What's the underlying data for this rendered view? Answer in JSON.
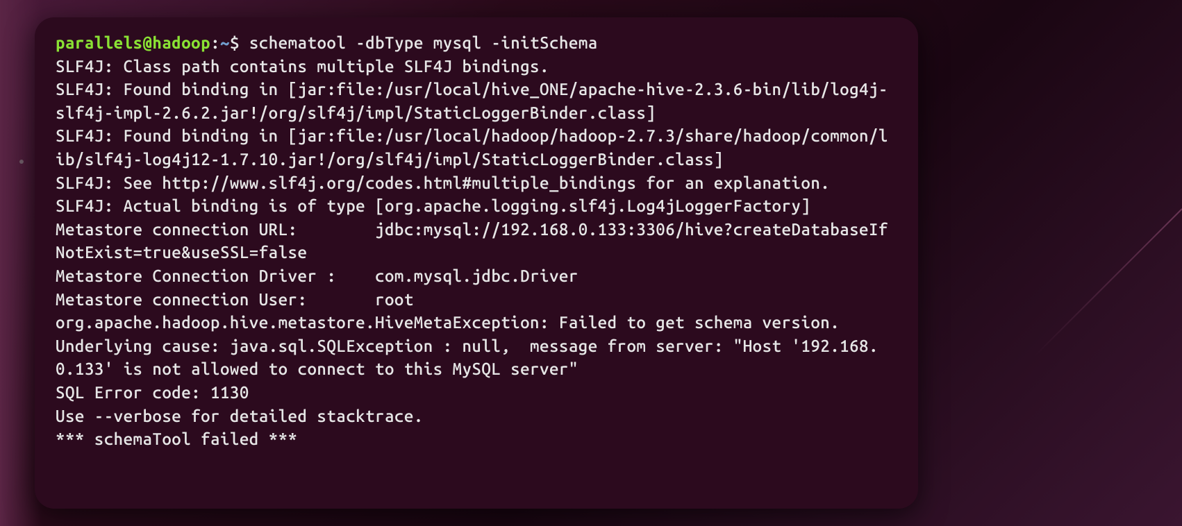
{
  "prompt": {
    "user": "parallels",
    "at": "@",
    "host": "hadoop",
    "colon": ":",
    "path": "~",
    "dollar": "$",
    "command": " schematool -dbType mysql -initSchema"
  },
  "output": {
    "line1": "SLF4J: Class path contains multiple SLF4J bindings.",
    "line2": "SLF4J: Found binding in [jar:file:/usr/local/hive_ONE/apache-hive-2.3.6-bin/lib/log4j-slf4j-impl-2.6.2.jar!/org/slf4j/impl/StaticLoggerBinder.class]",
    "line3": "SLF4J: Found binding in [jar:file:/usr/local/hadoop/hadoop-2.7.3/share/hadoop/common/lib/slf4j-log4j12-1.7.10.jar!/org/slf4j/impl/StaticLoggerBinder.class]",
    "line4": "SLF4J: See http://www.slf4j.org/codes.html#multiple_bindings for an explanation.",
    "line5": "SLF4J: Actual binding is of type [org.apache.logging.slf4j.Log4jLoggerFactory]",
    "line6": "Metastore connection URL:\t jdbc:mysql://192.168.0.133:3306/hive?createDatabaseIfNotExist=true&useSSL=false",
    "line7": "Metastore Connection Driver :\t com.mysql.jdbc.Driver",
    "line8": "Metastore connection User:\t root",
    "line9": "org.apache.hadoop.hive.metastore.HiveMetaException: Failed to get schema version.",
    "line10": "Underlying cause: java.sql.SQLException : null,  message from server: \"Host '192.168.0.133' is not allowed to connect to this MySQL server\"",
    "line11": "SQL Error code: 1130",
    "line12": "Use --verbose for detailed stacktrace.",
    "line13": "*** schemaTool failed ***"
  }
}
